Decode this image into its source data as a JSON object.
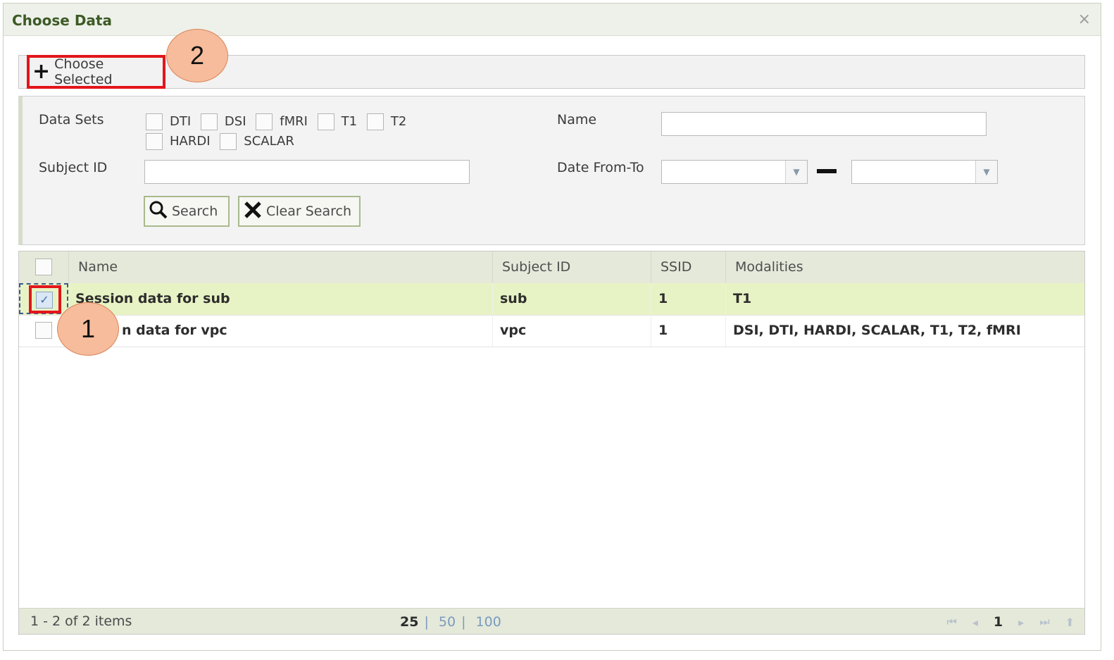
{
  "dialog": {
    "title": "Choose Data",
    "close_glyph": "×"
  },
  "toolbar": {
    "choose_label": "Choose Selected",
    "plus_glyph": "+"
  },
  "callouts": {
    "one": "1",
    "two": "2"
  },
  "filters": {
    "datasets_label": "Data Sets",
    "datasets": [
      "DTI",
      "DSI",
      "fMRI",
      "T1",
      "T2",
      "HARDI",
      "SCALAR"
    ],
    "name_label": "Name",
    "subject_label": "Subject ID",
    "date_label": "Date From-To",
    "search_label": "Search",
    "clear_label": "Clear Search"
  },
  "grid": {
    "columns": [
      "Name",
      "Subject ID",
      "SSID",
      "Modalities"
    ],
    "rows": [
      {
        "name": "Session data for sub",
        "subject": "sub",
        "ssid": "1",
        "modalities": "T1",
        "selected": true
      },
      {
        "name": "Session data for vpc",
        "subject": "vpc",
        "ssid": "1",
        "modalities": "DSI, DTI, HARDI, SCALAR, T1, T2, fMRI",
        "selected": false
      }
    ],
    "row2_visible_name": "n data for vpc"
  },
  "footer": {
    "info": "1 - 2 of 2 items",
    "page_sizes": [
      "25",
      "50",
      "100"
    ],
    "current_page": "1"
  },
  "icons": {
    "search": "search-icon",
    "clear": "x-icon",
    "first": "first-page-icon",
    "prev": "prev-page-icon",
    "next": "next-page-icon",
    "last": "last-page-icon",
    "refresh": "refresh-icon"
  }
}
